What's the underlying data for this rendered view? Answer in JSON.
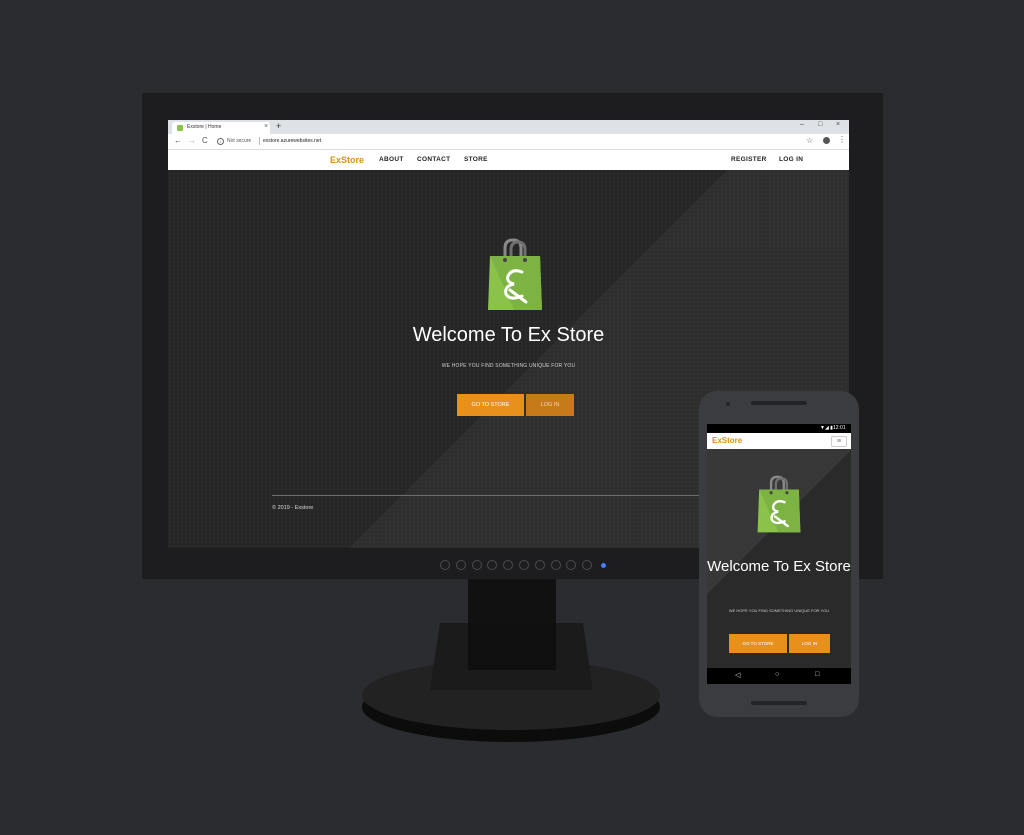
{
  "browser": {
    "tab_title": "Exstore | Home",
    "tab_close": "×",
    "new_tab": "+",
    "minimize": "–",
    "maximize": "□",
    "close": "×",
    "back": "←",
    "forward": "→",
    "reload": "C",
    "info": "i",
    "not_secure": "Not secure",
    "url": "exstore.azurewebsites.net",
    "star": "☆",
    "kebab": "⋮"
  },
  "site": {
    "brand": "ExStore",
    "nav": {
      "about": "ABOUT",
      "contact": "CONTACT",
      "store": "STORE",
      "register": "REGISTER",
      "login": "LOG IN"
    },
    "hero": {
      "title": "Welcome To Ex Store",
      "subtitle": "WE HOPE YOU FIND SOMETHING UNIQUE FOR YOU",
      "go_to_store": "GO TO STORE",
      "log_in": "LOG IN"
    },
    "footer": "© 2019 - Exstore"
  },
  "carousel": {
    "dot_count": 11,
    "active_index": 10
  },
  "phone": {
    "time": "12:01",
    "signal": "▼◢ ▮",
    "brand": "ExStore",
    "menu": "≡",
    "title": "Welcome To Ex Store",
    "subtitle": "WE HOPE YOU FIND SOMETHING UNIQUE FOR YOU",
    "go_to_store": "GO TO STORE",
    "log_in": "LOG IN",
    "nav_back": "◁",
    "nav_home": "○",
    "nav_recent": "□"
  },
  "colors": {
    "accent": "#e8901c",
    "bag_green": "#8bc34a",
    "background": "#2b2c30"
  }
}
